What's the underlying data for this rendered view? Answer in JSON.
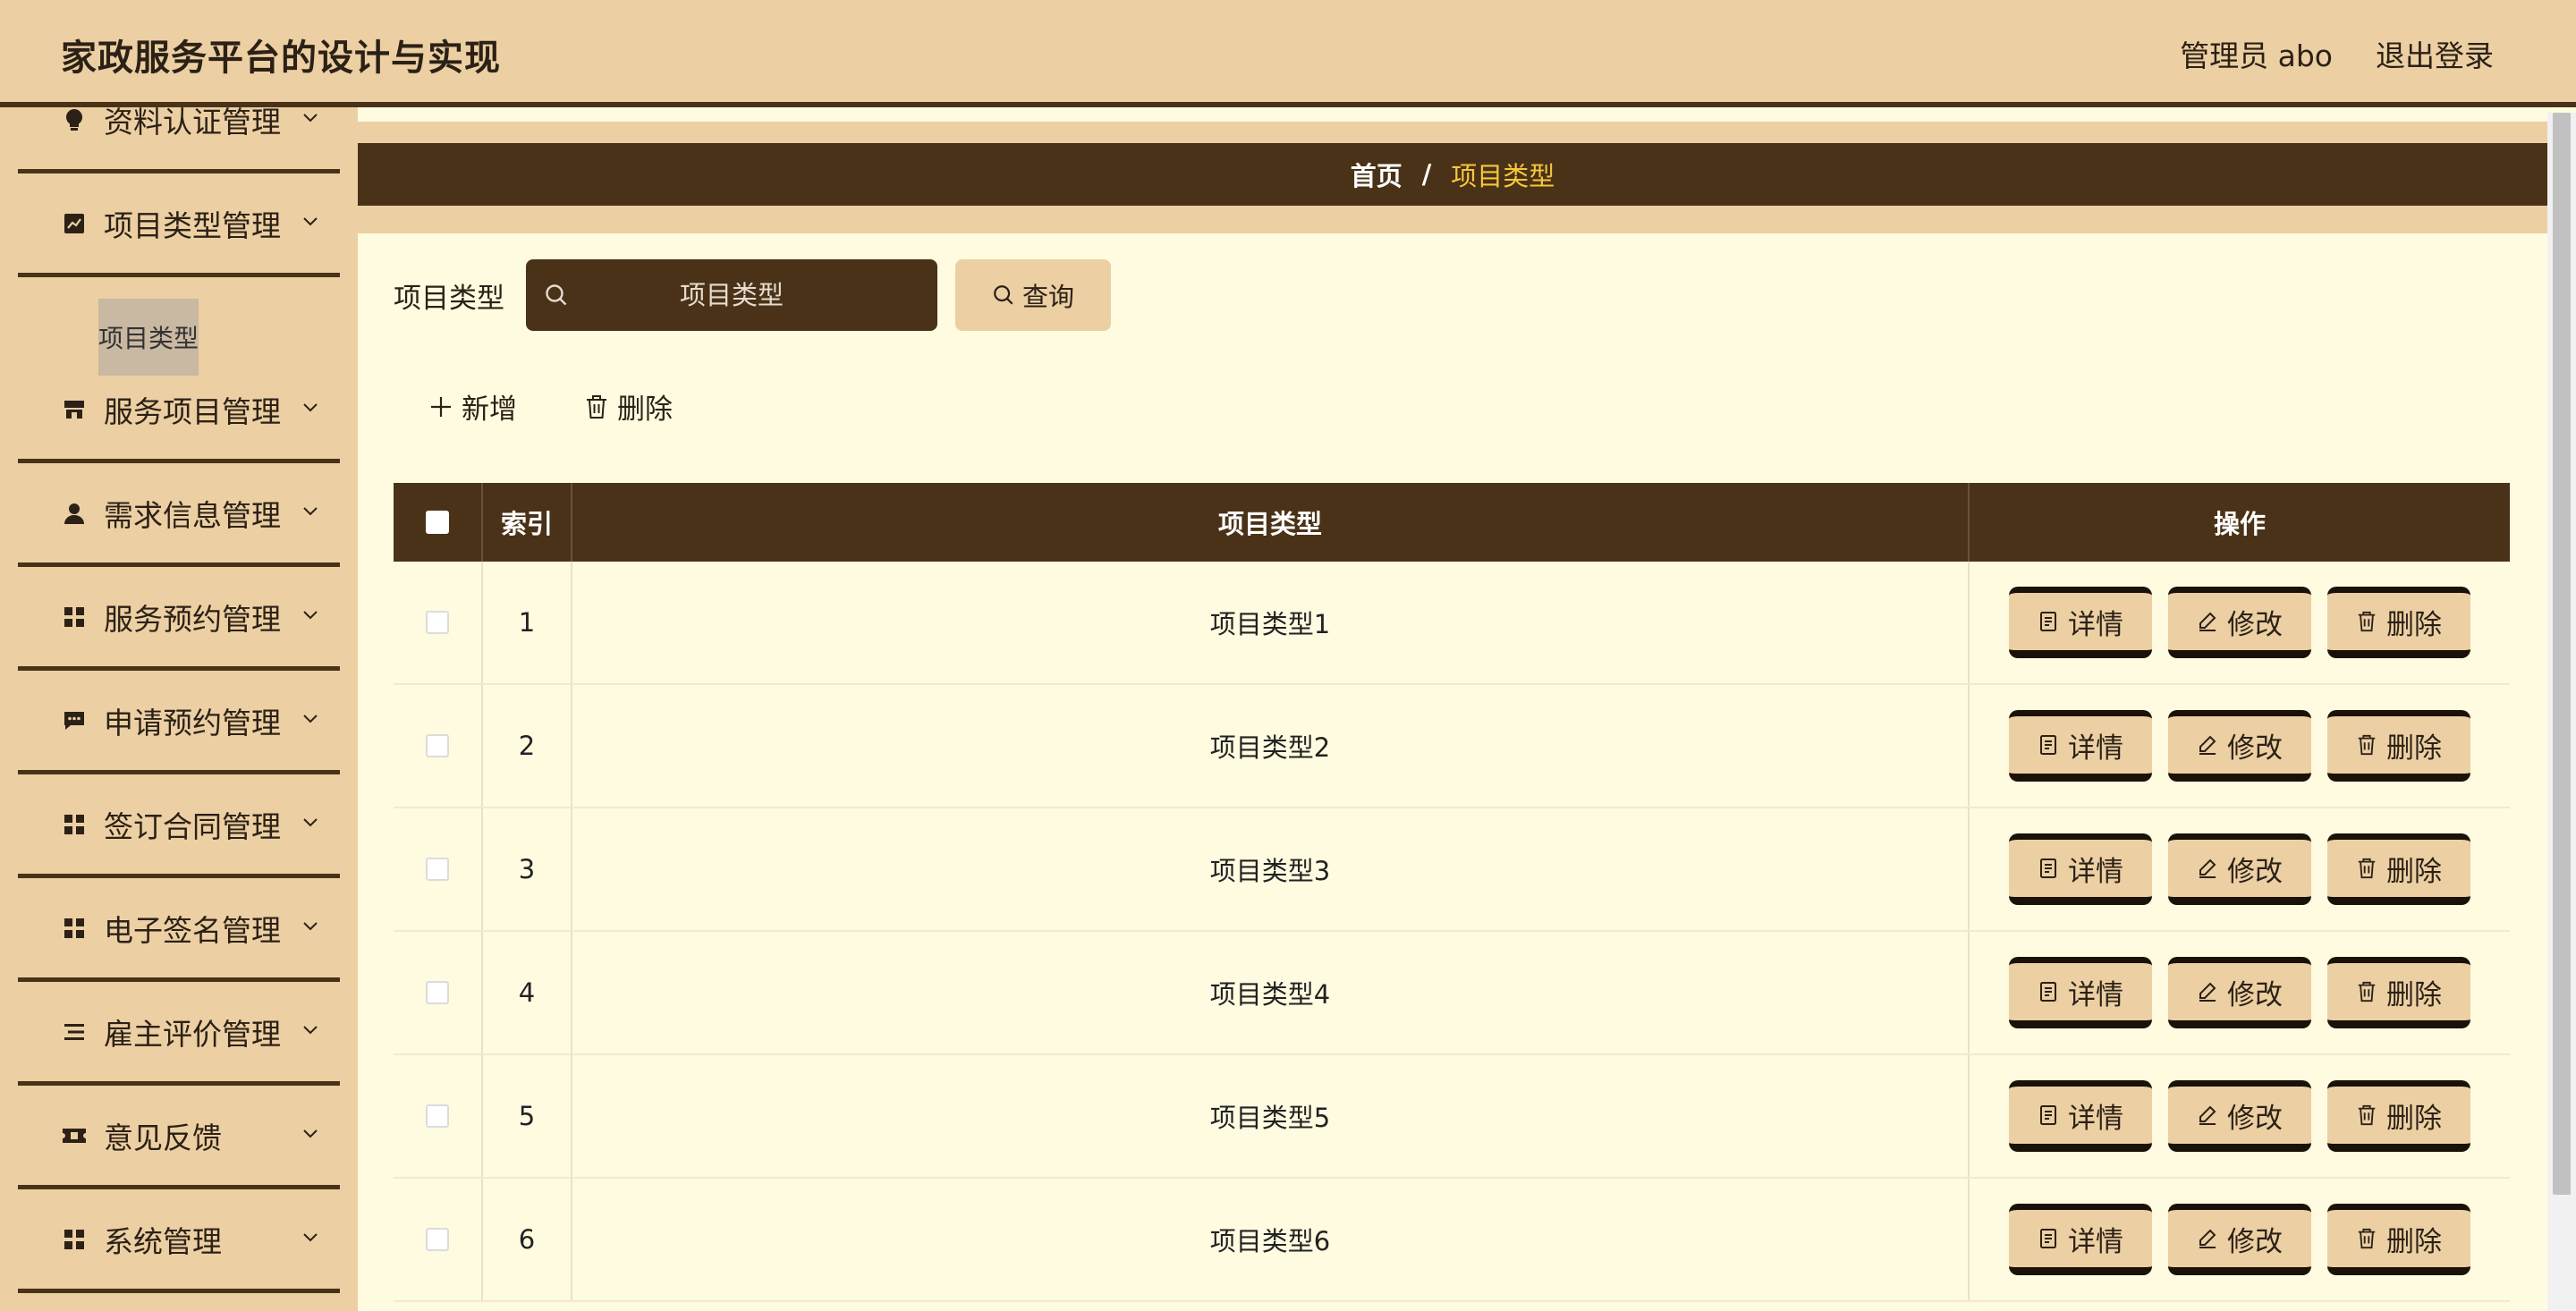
{
  "app": {
    "title": "家政服务平台的设计与实现"
  },
  "header": {
    "user_label": "管理员 abo",
    "logout_label": "退出登录"
  },
  "sidebar": {
    "items": [
      {
        "label": "资料认证管理",
        "icon": "bulb-icon"
      },
      {
        "label": "项目类型管理",
        "icon": "chart-icon"
      },
      {
        "label": "服务项目管理",
        "icon": "shop-icon"
      },
      {
        "label": "需求信息管理",
        "icon": "user-icon"
      },
      {
        "label": "服务预约管理",
        "icon": "grid-icon"
      },
      {
        "label": "申请预约管理",
        "icon": "message-icon"
      },
      {
        "label": "签订合同管理",
        "icon": "grid-icon"
      },
      {
        "label": "电子签名管理",
        "icon": "grid-icon"
      },
      {
        "label": "雇主评价管理",
        "icon": "list-icon"
      },
      {
        "label": "意见反馈",
        "icon": "ticket-icon"
      },
      {
        "label": "系统管理",
        "icon": "grid-icon"
      }
    ],
    "sub_item": "项目类型"
  },
  "breadcrumb": {
    "home": "首页",
    "separator": "/",
    "current": "项目类型"
  },
  "search": {
    "label": "项目类型",
    "placeholder": "项目类型",
    "query_label": "查询"
  },
  "actions": {
    "add_label": "新增",
    "delete_label": "删除"
  },
  "table": {
    "headers": {
      "index": "索引",
      "type": "项目类型",
      "ops": "操作"
    },
    "rows": [
      {
        "index": "1",
        "type": "项目类型1"
      },
      {
        "index": "2",
        "type": "项目类型2"
      },
      {
        "index": "3",
        "type": "项目类型3"
      },
      {
        "index": "4",
        "type": "项目类型4"
      },
      {
        "index": "5",
        "type": "项目类型5"
      },
      {
        "index": "6",
        "type": "项目类型6"
      }
    ],
    "op_labels": {
      "detail": "详情",
      "edit": "修改",
      "delete": "删除"
    }
  },
  "colors": {
    "accent_dark": "#4a3218",
    "accent_light": "#eccfa3",
    "background": "#fffbe0",
    "breadcrumb_current": "#f5c73b"
  }
}
